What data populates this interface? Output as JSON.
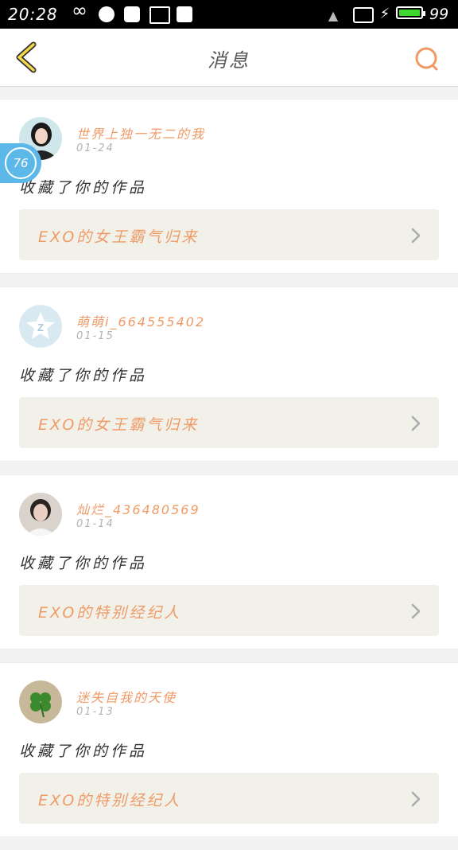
{
  "status_bar": {
    "time": "20:28",
    "battery_level": "99",
    "battery_color": "#3fd630",
    "icons": [
      "infinity-icon",
      "circle-app-icon",
      "ghost-icon",
      "image-icon",
      "shield-icon",
      "signal-icon",
      "screen-icon",
      "charging-icon",
      "battery-icon"
    ]
  },
  "nav": {
    "title": "消息",
    "back_icon": "chevron-left-icon",
    "search_icon": "search-icon",
    "accent": "#ef9a66"
  },
  "float_bubble": {
    "value": "76"
  },
  "messages": [
    {
      "user": "世界上独一无二的我",
      "date": "01-24",
      "action": "收藏了你的作品",
      "work": "EXO的女王霸气归来",
      "avatar": "portrait-icon"
    },
    {
      "user": "萌萌i_664555402",
      "date": "01-15",
      "action": "收藏了你的作品",
      "work": "EXO的女王霸气归来",
      "avatar": "qzone-default-icon"
    },
    {
      "user": "灿烂_436480569",
      "date": "01-14",
      "action": "收藏了你的作品",
      "work": "EXO的特别经纪人",
      "avatar": "portrait-icon"
    },
    {
      "user": "迷失自我的天使",
      "date": "01-13",
      "action": "收藏了你的作品",
      "work": "EXO的特别经纪人",
      "avatar": "clover-icon"
    }
  ]
}
